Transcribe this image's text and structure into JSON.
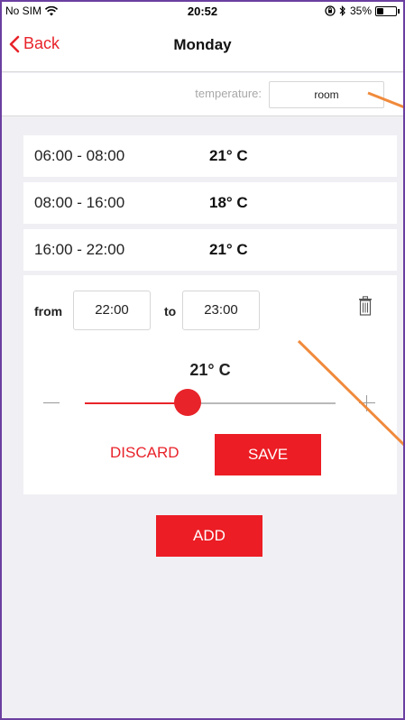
{
  "status_bar": {
    "carrier": "No SIM",
    "time": "20:52",
    "battery": "35%",
    "battery_level": 0.35
  },
  "nav": {
    "back_label": "Back",
    "title": "Monday"
  },
  "temperature_setting": {
    "label": "temperature:",
    "value": "room"
  },
  "schedule": [
    {
      "time": "06:00 - 08:00",
      "temp": "21° C"
    },
    {
      "time": "08:00 - 16:00",
      "temp": "18° C"
    },
    {
      "time": "16:00 - 22:00",
      "temp": "21° C"
    }
  ],
  "editor": {
    "from_label": "from",
    "from_value": "22:00",
    "to_label": "to",
    "to_value": "23:00",
    "temp": "21° C",
    "slider_fraction": 0.41,
    "discard_label": "DISCARD",
    "save_label": "SAVE"
  },
  "add_label": "ADD",
  "colors": {
    "accent": "#e8232a",
    "button": "#ec1d24",
    "annotation": "#f08a3c"
  }
}
